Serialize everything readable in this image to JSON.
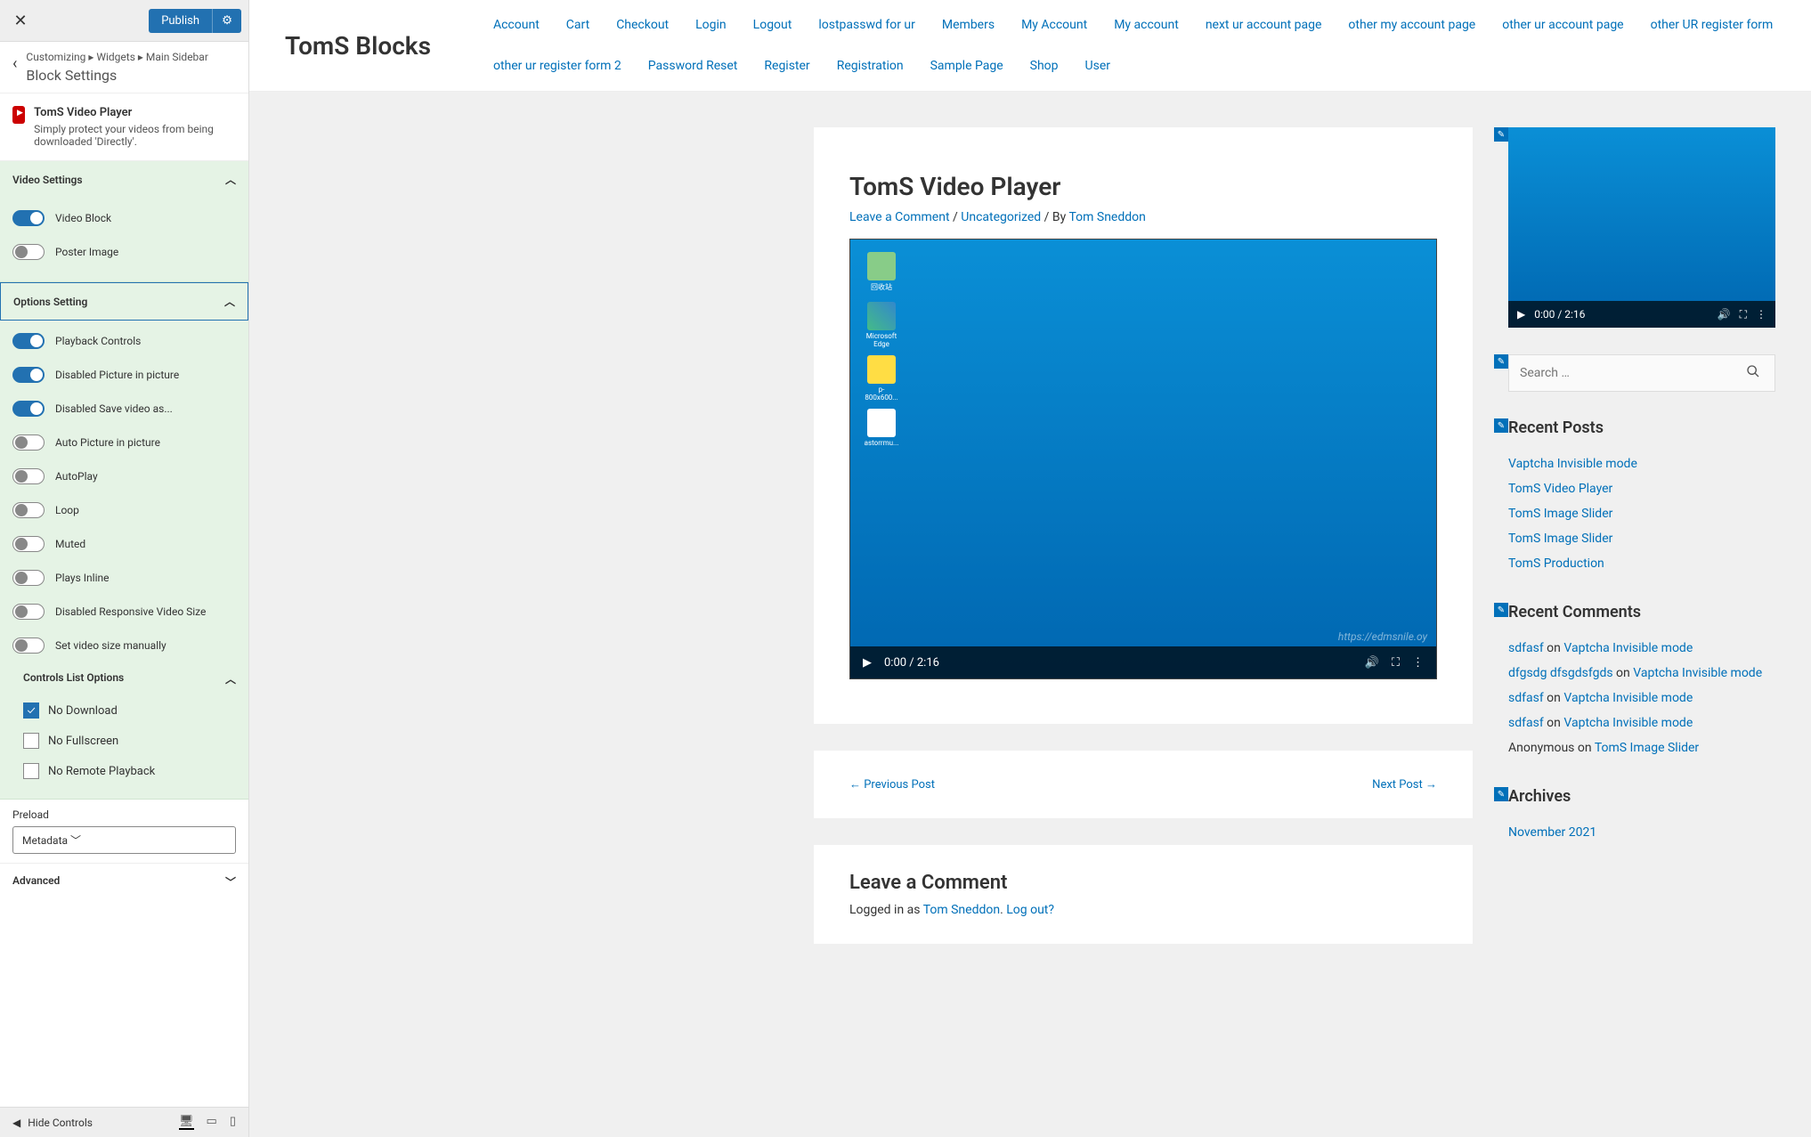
{
  "header": {
    "publish": "Publish"
  },
  "breadcrumb": {
    "path": "Customizing ▸ Widgets ▸ Main Sidebar",
    "title": "Block Settings"
  },
  "block": {
    "name": "TomS Video Player",
    "desc": "Simply protect your videos from being downloaded 'Directly'."
  },
  "sections": {
    "video": {
      "title": "Video Settings",
      "items": [
        {
          "label": "Video Block",
          "on": true
        },
        {
          "label": "Poster Image",
          "on": false
        }
      ]
    },
    "options": {
      "title": "Options Setting",
      "items": [
        {
          "label": "Playback Controls",
          "on": true
        },
        {
          "label": "Disabled Picture in picture",
          "on": true
        },
        {
          "label": "Disabled Save video as...",
          "on": true
        },
        {
          "label": "Auto Picture in picture",
          "on": false
        },
        {
          "label": "AutoPlay",
          "on": false
        },
        {
          "label": "Loop",
          "on": false
        },
        {
          "label": "Muted",
          "on": false
        },
        {
          "label": "Plays Inline",
          "on": false
        },
        {
          "label": "Disabled Responsive Video Size",
          "on": false
        },
        {
          "label": "Set video size manually",
          "on": false
        }
      ],
      "controls_list": {
        "title": "Controls List Options",
        "items": [
          {
            "label": "No Download",
            "checked": true
          },
          {
            "label": "No Fullscreen",
            "checked": false
          },
          {
            "label": "No Remote Playback",
            "checked": false
          }
        ]
      }
    },
    "preload": {
      "label": "Preload",
      "value": "Metadata"
    },
    "advanced": "Advanced"
  },
  "footer": {
    "hide": "Hide Controls"
  },
  "site": {
    "title": "TomS Blocks",
    "nav": [
      "Account",
      "Cart",
      "Checkout",
      "Login",
      "Logout",
      "lostpasswd for ur",
      "Members",
      "My Account",
      "My account",
      "next ur account page",
      "other my account page",
      "other ur account page",
      "other UR register form",
      "other ur register form 2",
      "Password Reset",
      "Register",
      "Registration",
      "Sample Page",
      "Shop",
      "User"
    ]
  },
  "post": {
    "title": "TomS Video Player",
    "leave_comment": "Leave a Comment",
    "category": "Uncategorized",
    "by": " / By ",
    "author": "Tom Sneddon",
    "video_time": "0:00 / 2:16",
    "prev": "← Previous Post",
    "next": "Next Post →"
  },
  "comment": {
    "title": "Leave a Comment",
    "logged_in_prefix": "Logged in as ",
    "logged_in_user": "Tom Sneddon",
    "logout": "Log out?"
  },
  "widgets": {
    "video_time": "0:00 / 2:16",
    "search_placeholder": "Search …",
    "recent_posts": {
      "title": "Recent Posts",
      "items": [
        "Vaptcha Invisible mode",
        "TomS Video Player",
        "TomS Image Slider",
        "TomS Image Slider",
        "TomS Production"
      ]
    },
    "recent_comments": {
      "title": "Recent Comments",
      "items": [
        {
          "author": "sdfasf",
          "on": " on ",
          "post": "Vaptcha Invisible mode"
        },
        {
          "author": "dfgsdg dfsgdsfgds",
          "on": " on ",
          "post": "Vaptcha Invisible mode"
        },
        {
          "author": "sdfasf",
          "on": " on ",
          "post": "Vaptcha Invisible mode"
        },
        {
          "author": "sdfasf",
          "on": " on ",
          "post": "Vaptcha Invisible mode"
        },
        {
          "author_plain": "Anonymous",
          "on": " on ",
          "post": "TomS Image Slider"
        }
      ]
    },
    "archives": {
      "title": "Archives",
      "items": [
        "November 2021"
      ]
    }
  }
}
